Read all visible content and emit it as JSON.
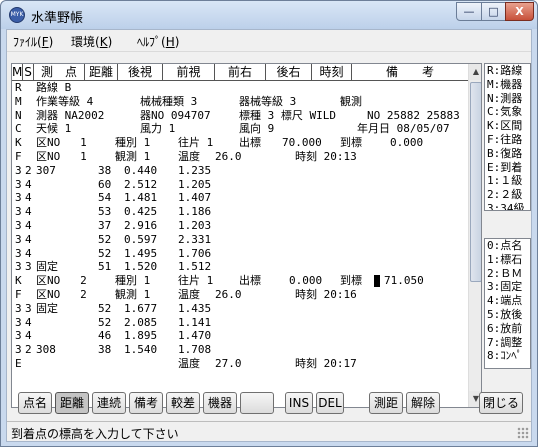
{
  "window": {
    "title": "水準野帳",
    "icon": "MYK"
  },
  "titlebar_buttons": {
    "minimize": "—",
    "maximize": "□",
    "close": "X"
  },
  "menu": [
    {
      "label": "ﾌｧｲﾙ(",
      "acc": "F",
      "end": ")"
    },
    {
      "label": "環境(",
      "acc": "K",
      "end": ")"
    },
    {
      "label": "ﾍﾙﾌﾟ(",
      "acc": "H",
      "end": ")"
    }
  ],
  "table": {
    "columns": [
      "M",
      "S",
      "測　点",
      "距離",
      "後視",
      "前視",
      "前右",
      "後右",
      "時刻",
      "備　　考"
    ],
    "rows": [
      [
        "R",
        "路線 B"
      ],
      [
        "M",
        "作業等級 4",
        "械械種類 3",
        "器械等級 3",
        "観測"
      ],
      [
        "N",
        "測器 NA2002",
        "器NO 094707",
        "標種 3 標尺 WILD",
        "NO 25882 25883"
      ],
      [
        "C",
        "天候 1",
        "風力 1",
        "風向 9",
        "年月日 08/05/07"
      ],
      [
        "K",
        "区NO   1",
        "種別 1",
        "往片 1",
        "出標",
        "70.000",
        "到標",
        "0.000"
      ],
      [
        "F",
        "区NO   1",
        "観測 1",
        "温度",
        "26.0",
        "時刻 20:13"
      ],
      [
        "3",
        "2",
        "307",
        "38",
        "0.440",
        "1.235"
      ],
      [
        "3",
        "4",
        "",
        "60",
        "2.512",
        "1.205"
      ],
      [
        "3",
        "4",
        "",
        "54",
        "1.481",
        "1.407"
      ],
      [
        "3",
        "4",
        "",
        "53",
        "0.425",
        "1.186"
      ],
      [
        "3",
        "4",
        "",
        "37",
        "2.916",
        "1.203"
      ],
      [
        "3",
        "4",
        "",
        "52",
        "0.597",
        "2.331"
      ],
      [
        "3",
        "4",
        "",
        "52",
        "1.495",
        "1.706"
      ],
      [
        "3",
        "3",
        "固定",
        "51",
        "1.520",
        "1.512"
      ],
      [
        "K",
        "区NO   2",
        "種別 1",
        "往片 1",
        "出標",
        "0.000",
        "到標",
        "71.050"
      ],
      [
        "F",
        "区NO   2",
        "観測 1",
        "温度",
        "26.0",
        "時刻 20:16"
      ],
      [
        "3",
        "3",
        "固定",
        "52",
        "1.677",
        "1.435"
      ],
      [
        "3",
        "4",
        "",
        "52",
        "2.085",
        "1.141"
      ],
      [
        "3",
        "4",
        "",
        "46",
        "1.895",
        "1.470"
      ],
      [
        "3",
        "2",
        "308",
        "38",
        "1.540",
        "1.708"
      ],
      [
        "E",
        "温度",
        "27.0",
        "時刻 20:17"
      ]
    ]
  },
  "legend_top": [
    "R:路線",
    "M:機器",
    "N:測器",
    "C:気象",
    "K:区間",
    "F:往路",
    "B:復路",
    "E:到着",
    "1:１級",
    "2:２級",
    "3:34級"
  ],
  "legend_bottom": [
    "0:点名",
    "1:標石",
    "2:ＢＭ",
    "3:固定",
    "4:端点",
    "5:放後",
    "6:放前",
    "7:調整",
    "8:ｺﾝﾍﾟ"
  ],
  "buttons": {
    "tenmei": "点名",
    "kyori": "距離",
    "renzoku": "連続",
    "biko": "備考",
    "kansa": "較差",
    "kiki": "機器",
    "blank": "",
    "ins": "INS",
    "del": "DEL",
    "sokkyo": "測距",
    "kaijo": "解除",
    "close": "閉じる"
  },
  "status": {
    "message": "到着点の標高を入力して下さい"
  }
}
